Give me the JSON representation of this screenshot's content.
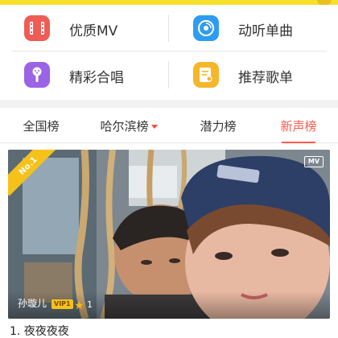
{
  "colors": {
    "accent": "#ff5a4d",
    "mv_icon": "#ef5c55",
    "music_icon": "#2f9cf3",
    "mic_icon": "#9b63e6",
    "playlist_icon": "#f5b62a",
    "rank_badge": "#f5c21b"
  },
  "menu": {
    "items": [
      {
        "label": "优质MV",
        "icon": "film-icon"
      },
      {
        "label": "动听单曲",
        "icon": "disc-icon"
      },
      {
        "label": "精彩合唱",
        "icon": "microphone-icon"
      },
      {
        "label": "推荐歌单",
        "icon": "playlist-icon"
      }
    ]
  },
  "tabs": [
    {
      "label": "全国榜",
      "active": false
    },
    {
      "label": "哈尔滨榜",
      "active": false,
      "has_dropdown": true
    },
    {
      "label": "潜力榜",
      "active": false
    },
    {
      "label": "新声榜",
      "active": true
    }
  ],
  "feature": {
    "rank_label": "No.1",
    "mv_label": "MV",
    "artist": "孙璇儿",
    "vip_label": "VIP1",
    "star_count": "1",
    "song_title": "1. 夜夜夜夜"
  }
}
